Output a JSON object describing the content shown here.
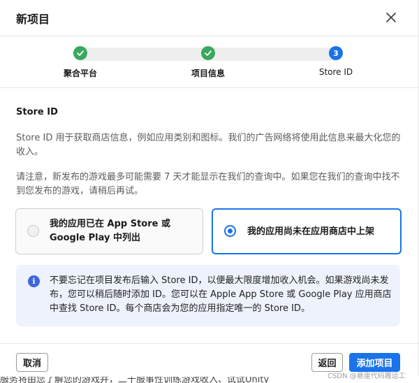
{
  "dialog": {
    "title": "新项目"
  },
  "stepper": {
    "steps": [
      {
        "label": "聚合平台",
        "status": "done"
      },
      {
        "label": "项目信息",
        "status": "done"
      },
      {
        "label": "Store ID",
        "status": "current",
        "number": "3"
      }
    ]
  },
  "content": {
    "section_title": "Store ID",
    "paragraph1": "Store ID 用于获取商店信息，例如应用类别和图标。我们的广告网络将使用此信息来最大化您的收入。",
    "paragraph2": "请注意，新发布的游戏最多可能需要 7 天才能显示在我们的查询中。如果您在我们的查询中找不到您发布的游戏，请稍后再试。"
  },
  "options": [
    {
      "label": "我的应用已在 App Store 或 Google Play 中列出",
      "selected": false
    },
    {
      "label": "我的应用尚未在应用商店中上架",
      "selected": true
    }
  ],
  "info": {
    "icon": "i",
    "text": "不要忘记在项目发布后输入 Store ID，以便最大限度增加收入机会。如果游戏尚未发布，您可以稍后随时添加 ID。您可以在 Apple App Store 或 Google Play 应用商店中查找 Store ID。每个商店会为您的应用指定唯一的 Store ID。"
  },
  "footer": {
    "cancel_label": "取消",
    "back_label": "返回",
    "add_label": "添加项目"
  },
  "watermark": "CSDN @悬崖代码搬运工",
  "background_text": "服务将由您了解您的游戏并，二十服事性训练游戏收入、试试Unity"
}
